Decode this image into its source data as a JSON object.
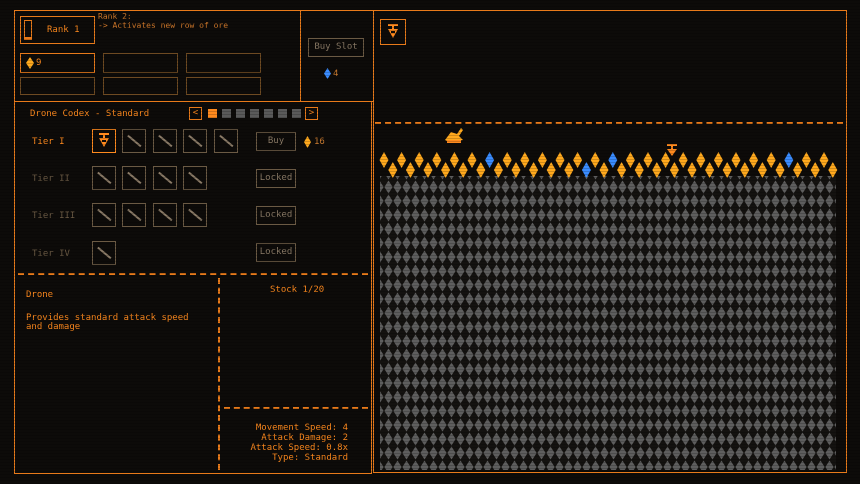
{
  "rank": {
    "button_label": "Rank 1",
    "next_title": "Rank 2:",
    "next_desc": "-> Activates new row of ore",
    "currency_value": "9"
  },
  "shop": {
    "buy_slot_label": "Buy Slot",
    "gems_value": "4"
  },
  "codex": {
    "title": "Drone Codex - Standard",
    "prev_label": "<",
    "next_label": ">",
    "page_count": 7,
    "current_page": 1,
    "tiers": [
      {
        "label": "Tier I",
        "action": "Buy",
        "price": "16"
      },
      {
        "label": "Tier II",
        "action": "Locked"
      },
      {
        "label": "Tier III",
        "action": "Locked"
      },
      {
        "label": "Tier IV",
        "action": "Locked"
      }
    ]
  },
  "details": {
    "name": "Drone",
    "description_line1": "Provides standard attack speed",
    "description_line2": "and damage",
    "stock": "Stock 1/20",
    "stats": [
      "Movement Speed: 4",
      "Attack Damage: 2",
      "Attack Speed: 0.8x",
      "Type: Standard"
    ]
  },
  "colors": {
    "accent": "#ff8a1e",
    "ore_orange": "#ffa91e",
    "ore_blue": "#3a8cff",
    "rock_grey": "#5e5e5e",
    "background": "#0d0b09"
  },
  "icons": {
    "drone": "drone-icon",
    "ore": "ore-gem-icon",
    "gem": "blue-gem-icon"
  }
}
